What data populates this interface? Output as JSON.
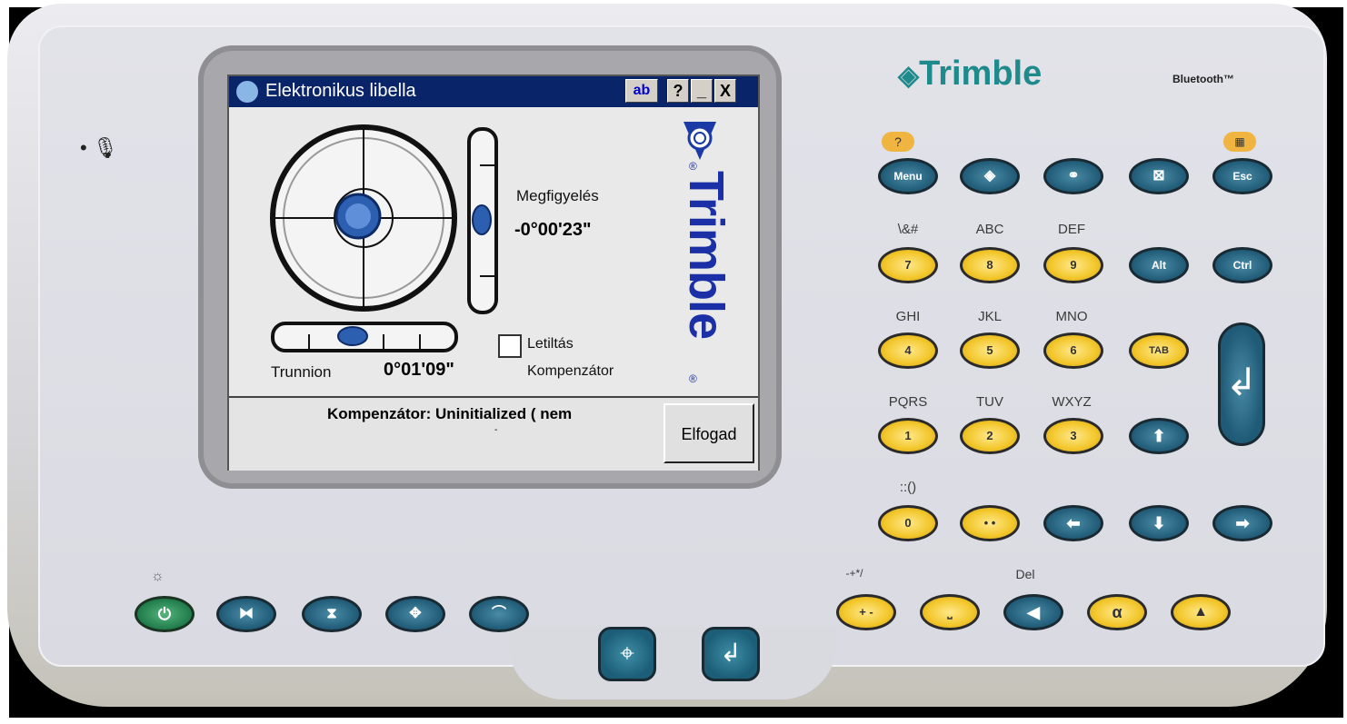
{
  "window": {
    "title": "Elektronikus libella",
    "input_indicator": "ab",
    "help_button": "?",
    "minimize_button": "_",
    "close_button": "X"
  },
  "level": {
    "observation_label": "Megfigyelés",
    "observation_value": "-0°00'23\"",
    "trunnion_label": "Trunnion",
    "trunnion_value": "0°01'09\"",
    "disable_checkbox_label_1": "Letiltás",
    "disable_checkbox_label_2": "Kompenzátor",
    "disable_checked": false,
    "brand_vertical": "Trimble",
    "registered": "®"
  },
  "status": {
    "text": "Kompenzátor: Uninitialized ( nem",
    "text_cont": "-",
    "accept_button": "Elfogad"
  },
  "device": {
    "brand": "Trimble",
    "bluetooth": "Bluetooth™",
    "help_key": "?",
    "keys": {
      "menu": "Menu",
      "esc": "Esc",
      "alt": "Alt",
      "ctrl": "Ctrl",
      "tab": "TAB",
      "k7": "7",
      "k8": "8",
      "k9": "9",
      "k4": "4",
      "k5": "5",
      "k6": "6",
      "k1": "1",
      "k2": "2",
      "k3": "3",
      "k0": "0",
      "l7": "\\&#",
      "l8": "ABC",
      "l9": "DEF",
      "l4": "GHI",
      "l5": "JKL",
      "l6": "MNO",
      "l1": "PQRS",
      "l2": "TUV",
      "l3": "WXYZ",
      "l0": "::()",
      "plusminus_top": "-+*/",
      "del_top": "Del",
      "plusminus": "+ -",
      "dots": "• •"
    }
  }
}
